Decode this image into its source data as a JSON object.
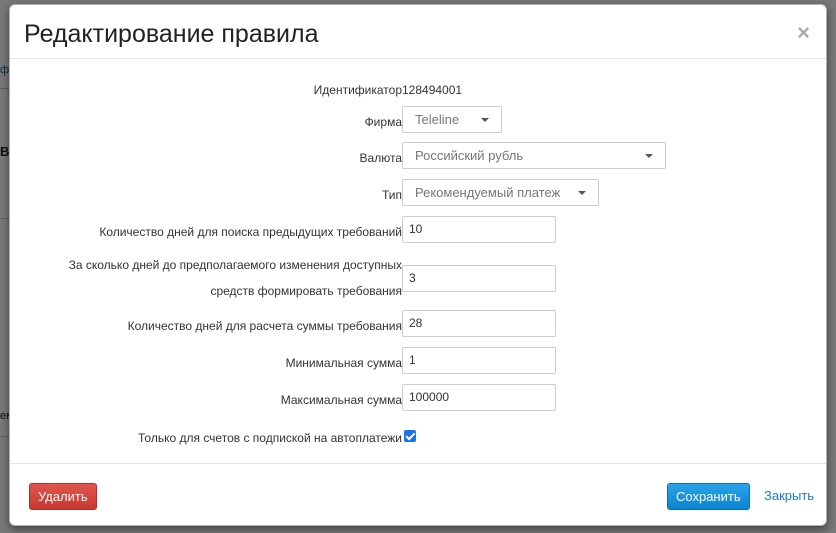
{
  "background": {
    "fragment_1": "ф",
    "fragment_2": "В",
    "fragment_3": "ем"
  },
  "modal": {
    "title": "Редактирование правила",
    "close_label": "×"
  },
  "form": {
    "identifier": {
      "label": "Идентификатор",
      "value": "128494001"
    },
    "firm": {
      "label": "Фирма",
      "selected": "Teleline"
    },
    "currency": {
      "label": "Валюта",
      "selected": "Российский рубль"
    },
    "type": {
      "label": "Тип",
      "selected": "Рекомендуемый платеж"
    },
    "days_search": {
      "label": "Количество дней для поиска предыдущих требований",
      "value": "10"
    },
    "days_before": {
      "label_line1": "За сколько дней до предполагаемого изменения доступных",
      "label_line2": "средств формировать требования",
      "value": "3"
    },
    "days_calc": {
      "label": "Количество дней для расчета суммы требования",
      "value": "28"
    },
    "min_sum": {
      "label": "Минимальная сумма",
      "value": "1"
    },
    "max_sum": {
      "label": "Максимальная сумма",
      "value": "100000"
    },
    "autopay_only": {
      "label": "Только для счетов с подпиской на автоплатежи",
      "checked": true
    }
  },
  "footer": {
    "delete_label": "Удалить",
    "save_label": "Сохранить",
    "close_label": "Закрыть"
  },
  "colors": {
    "danger": "#d9534f",
    "primary": "#1a8fdc",
    "link": "#1a7bc4",
    "checkbox": "#1a73e8"
  }
}
